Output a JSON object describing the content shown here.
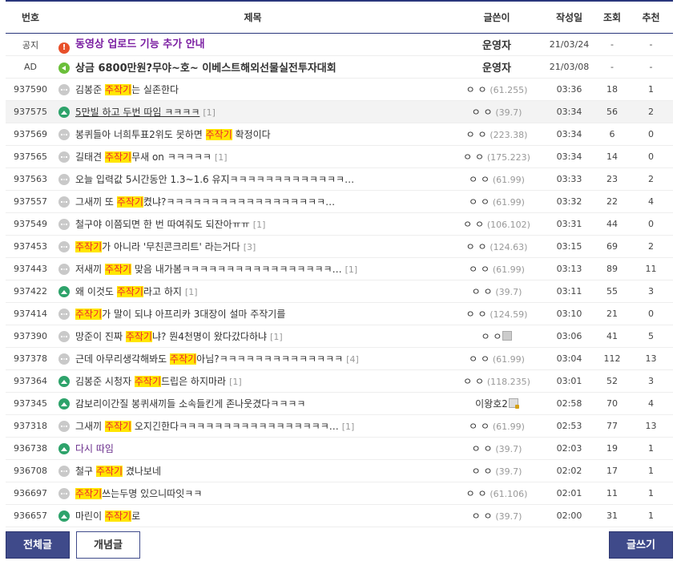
{
  "headers": {
    "num": "번호",
    "subject": "제목",
    "writer": "글쓴이",
    "date": "작성일",
    "views": "조회",
    "recommend": "추천"
  },
  "notices": [
    {
      "num": "공지",
      "icon": "notice-icon",
      "title": "동영상 업로드 기능 추가 안내",
      "writer": "운영자",
      "date": "21/03/24",
      "views": "-",
      "recommend": "-"
    },
    {
      "num": "AD",
      "icon": "speaker-icon",
      "title": "상금 6800만원?무야~호~ 이베스트해외선물실전투자대회",
      "writer": "운영자",
      "date": "21/03/08",
      "views": "-",
      "recommend": "-"
    }
  ],
  "rows": [
    {
      "num": "937590",
      "icon": "text-post-icon",
      "pre": "김봉준 ",
      "hl": "주작기",
      "post": "는 실존한다",
      "reply": "",
      "writer": "ㅇ ㅇ",
      "ip": "(61.255)",
      "date": "03:36",
      "views": "18",
      "recommend": "1"
    },
    {
      "num": "937575",
      "icon": "image-post-icon",
      "pre": "5만빌 하고 두번 따임 ㅋㅋㅋㅋ",
      "hl": "",
      "post": "",
      "reply": "[1]",
      "writer": "ㅇ ㅇ",
      "ip": "(39.7)",
      "date": "03:34",
      "views": "56",
      "recommend": "2"
    },
    {
      "num": "937569",
      "icon": "text-post-icon",
      "pre": "봉퀴들아 너희투표2위도 못하면 ",
      "hl": "주작기",
      "post": " 확정이다",
      "reply": "",
      "writer": "ㅇ ㅇ",
      "ip": "(223.38)",
      "date": "03:34",
      "views": "6",
      "recommend": "0"
    },
    {
      "num": "937565",
      "icon": "text-post-icon",
      "pre": "길태견 ",
      "hl": "주작기",
      "post": "무새 on ㅋㅋㅋㅋㅋ",
      "reply": "[1]",
      "writer": "ㅇ ㅇ",
      "ip": "(175.223)",
      "date": "03:34",
      "views": "14",
      "recommend": "0"
    },
    {
      "num": "937563",
      "icon": "text-post-icon",
      "pre": "오늘 입력값 5시간동안 1.3~1.6 유지ㅋㅋㅋㅋㅋㅋㅋㅋㅋㅋㅋㅋㅋ…",
      "hl": "",
      "post": "",
      "reply": "",
      "writer": "ㅇ ㅇ",
      "ip": "(61.99)",
      "date": "03:33",
      "views": "23",
      "recommend": "2"
    },
    {
      "num": "937557",
      "icon": "text-post-icon",
      "pre": "그새끼 또 ",
      "hl": "주작기",
      "post": "켰냐?ㅋㅋㅋㅋㅋㅋㅋㅋㅋㅋㅋㅋㅋㅋㅋㅋㅋㅋ…",
      "reply": "",
      "writer": "ㅇ ㅇ",
      "ip": "(61.99)",
      "date": "03:32",
      "views": "22",
      "recommend": "4"
    },
    {
      "num": "937549",
      "icon": "text-post-icon",
      "pre": "철구야 이쯤되면 한 번 따여줘도 되잔아ㅠㅠ",
      "hl": "",
      "post": "",
      "reply": "[1]",
      "writer": "ㅇ ㅇ",
      "ip": "(106.102)",
      "date": "03:31",
      "views": "44",
      "recommend": "0"
    },
    {
      "num": "937453",
      "icon": "text-post-icon",
      "pre": "",
      "hl": "주작기",
      "post": "가 아니라 '무친콘크리트' 라는거다",
      "reply": "[3]",
      "writer": "ㅇ ㅇ",
      "ip": "(124.63)",
      "date": "03:15",
      "views": "69",
      "recommend": "2"
    },
    {
      "num": "937443",
      "icon": "text-post-icon",
      "pre": "저새끼 ",
      "hl": "주작기",
      "post": " 맞음 내가봄ㅋㅋㅋㅋㅋㅋㅋㅋㅋㅋㅋㅋㅋㅋㅋㅋㅋ…",
      "reply": "[1]",
      "writer": "ㅇ ㅇ",
      "ip": "(61.99)",
      "date": "03:13",
      "views": "89",
      "recommend": "11"
    },
    {
      "num": "937422",
      "icon": "image-post-icon",
      "pre": "왜 이것도 ",
      "hl": "주작기",
      "post": "라고 하지",
      "reply": "[1]",
      "writer": "ㅇ ㅇ",
      "ip": "(39.7)",
      "date": "03:11",
      "views": "55",
      "recommend": "3"
    },
    {
      "num": "937414",
      "icon": "text-post-icon",
      "pre": "",
      "hl": "주작기",
      "post": "가 말이 되냐 아프리카 3대장이 설마 주작기를",
      "reply": "",
      "writer": "ㅇ ㅇ",
      "ip": "(124.59)",
      "date": "03:10",
      "views": "21",
      "recommend": "0"
    },
    {
      "num": "937390",
      "icon": "text-post-icon",
      "pre": "망준이 진짜 ",
      "hl": "주작기",
      "post": "냐? 뭔4천명이 왔다갔다하냐",
      "reply": "[1]",
      "writer": "ㅇ ㅇ",
      "ip": "",
      "lock": "plain",
      "date": "03:06",
      "views": "41",
      "recommend": "5"
    },
    {
      "num": "937378",
      "icon": "text-post-icon",
      "pre": "근데 아무리생각해봐도 ",
      "hl": "주작기",
      "post": "아님?ㅋㅋㅋㅋㅋㅋㅋㅋㅋㅋㅋㅋㅋㅋ",
      "reply": "[4]",
      "writer": "ㅇ ㅇ",
      "ip": "(61.99)",
      "date": "03:04",
      "views": "112",
      "recommend": "13"
    },
    {
      "num": "937364",
      "icon": "image-post-icon",
      "pre": "김봉준 시청자 ",
      "hl": "주작기",
      "post": "드립은 하지마라",
      "reply": "[1]",
      "writer": "ㅇ ㅇ",
      "ip": "(118.235)",
      "date": "03:01",
      "views": "52",
      "recommend": "3"
    },
    {
      "num": "937345",
      "icon": "image-post-icon",
      "pre": "감보리이간질 봉퀴새끼들 소속들킨게 존나웃겼다ㅋㅋㅋㅋ",
      "hl": "",
      "post": "",
      "reply": "",
      "writer": "이왕호2",
      "ip": "",
      "lock": "key",
      "date": "02:58",
      "views": "70",
      "recommend": "4"
    },
    {
      "num": "937318",
      "icon": "text-post-icon",
      "pre": "그새끼 ",
      "hl": "주작기",
      "post": " 오지긴한다ㅋㅋㅋㅋㅋㅋㅋㅋㅋㅋㅋㅋㅋㅋㅋㅋㅋ…",
      "reply": "[1]",
      "writer": "ㅇ ㅇ",
      "ip": "(61.99)",
      "date": "02:53",
      "views": "77",
      "recommend": "13"
    },
    {
      "num": "936738",
      "icon": "image-post-icon",
      "pre": "다시 따임",
      "hl": "",
      "post": "",
      "reply": "",
      "writer": "ㅇ ㅇ",
      "ip": "(39.7)",
      "date": "02:03",
      "views": "19",
      "recommend": "1"
    },
    {
      "num": "936708",
      "icon": "text-post-icon",
      "pre": "철구 ",
      "hl": "주작기",
      "post": " 겼나보네",
      "reply": "",
      "writer": "ㅇ ㅇ",
      "ip": "(39.7)",
      "date": "02:02",
      "views": "17",
      "recommend": "1"
    },
    {
      "num": "936697",
      "icon": "text-post-icon",
      "pre": "",
      "hl": "주작기",
      "post": "쓰는두명 있으니따잇ㅋㅋ",
      "reply": "",
      "writer": "ㅇ ㅇ",
      "ip": "(61.106)",
      "date": "02:01",
      "views": "11",
      "recommend": "1"
    },
    {
      "num": "936657",
      "icon": "image-post-icon",
      "pre": "마린이 ",
      "hl": "주작기",
      "post": "로",
      "reply": "",
      "writer": "ㅇ ㅇ",
      "ip": "(39.7)",
      "date": "02:00",
      "views": "31",
      "recommend": "1"
    }
  ],
  "buttons": {
    "all": "전체글",
    "concept": "개념글",
    "write": "글쓰기"
  }
}
